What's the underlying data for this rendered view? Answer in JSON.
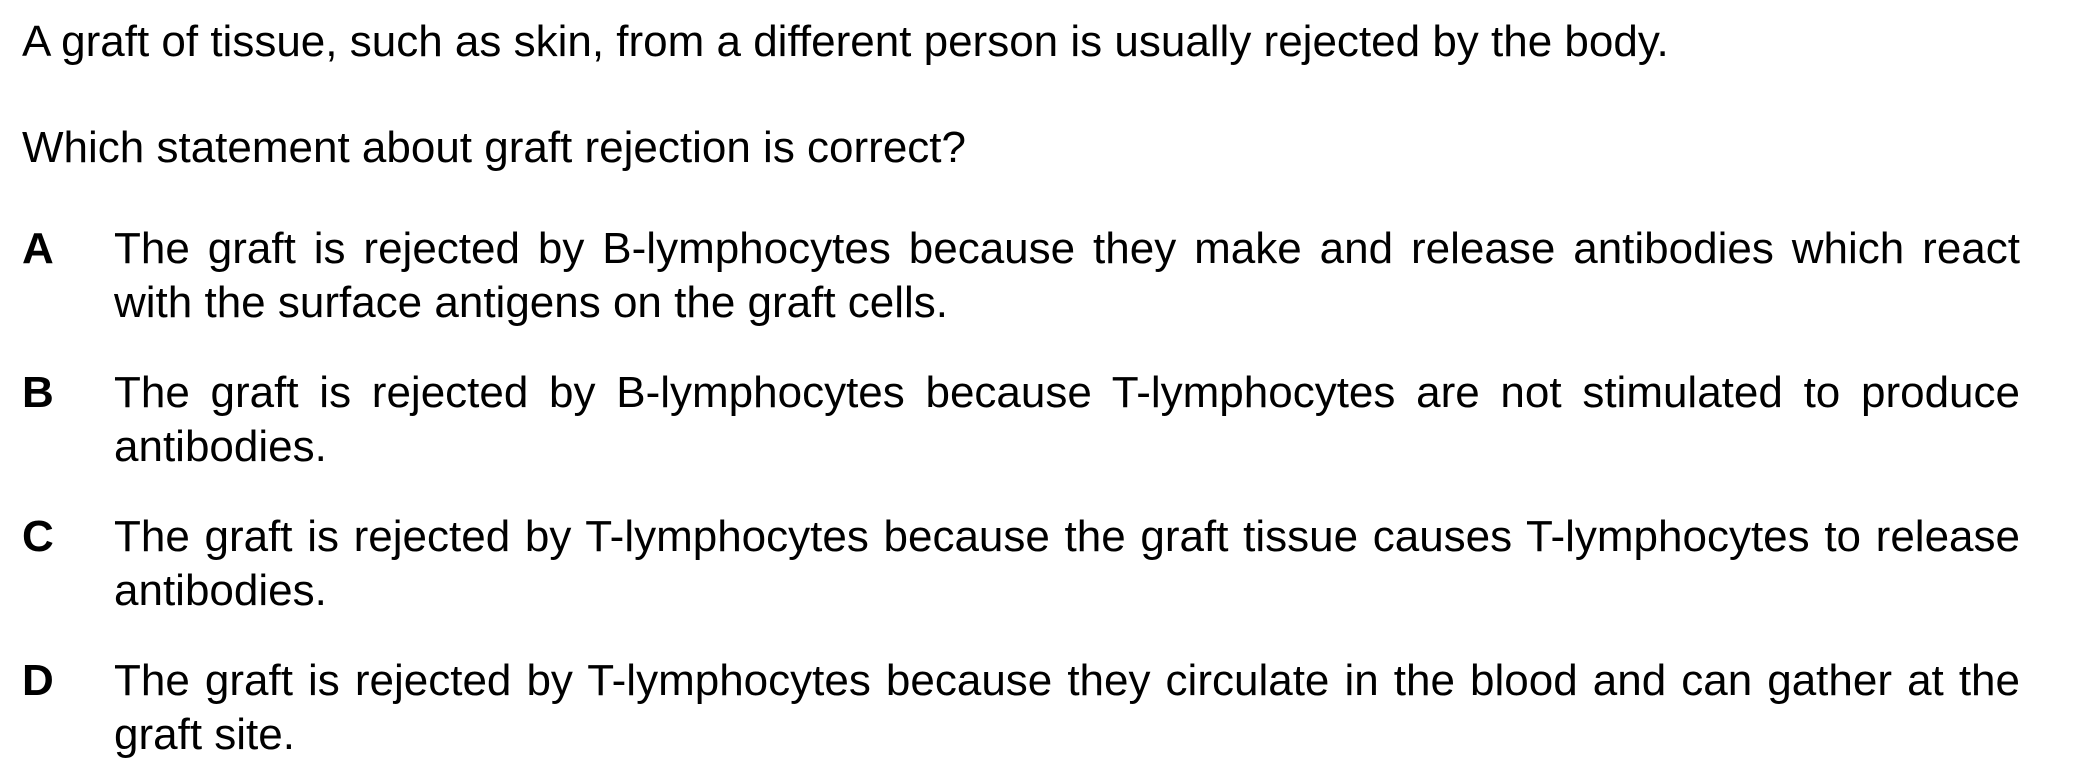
{
  "question": {
    "intro": "A graft of tissue, such as skin, from a different person is usually rejected by the body.",
    "prompt": "Which statement about graft rejection is correct?"
  },
  "options": [
    {
      "letter": "A",
      "text": "The graft is rejected by B-lymphocytes because they make and release antibodies which react with the surface antigens on the graft cells."
    },
    {
      "letter": "B",
      "text": "The graft is rejected by B-lymphocytes because T-lymphocytes are not stimulated to produce antibodies."
    },
    {
      "letter": "C",
      "text": "The graft is rejected by T-lymphocytes because the graft tissue causes T-lymphocytes to release antibodies."
    },
    {
      "letter": "D",
      "text": "The graft is rejected by T-lymphocytes because they circulate in the blood and can gather at the graft site."
    }
  ]
}
